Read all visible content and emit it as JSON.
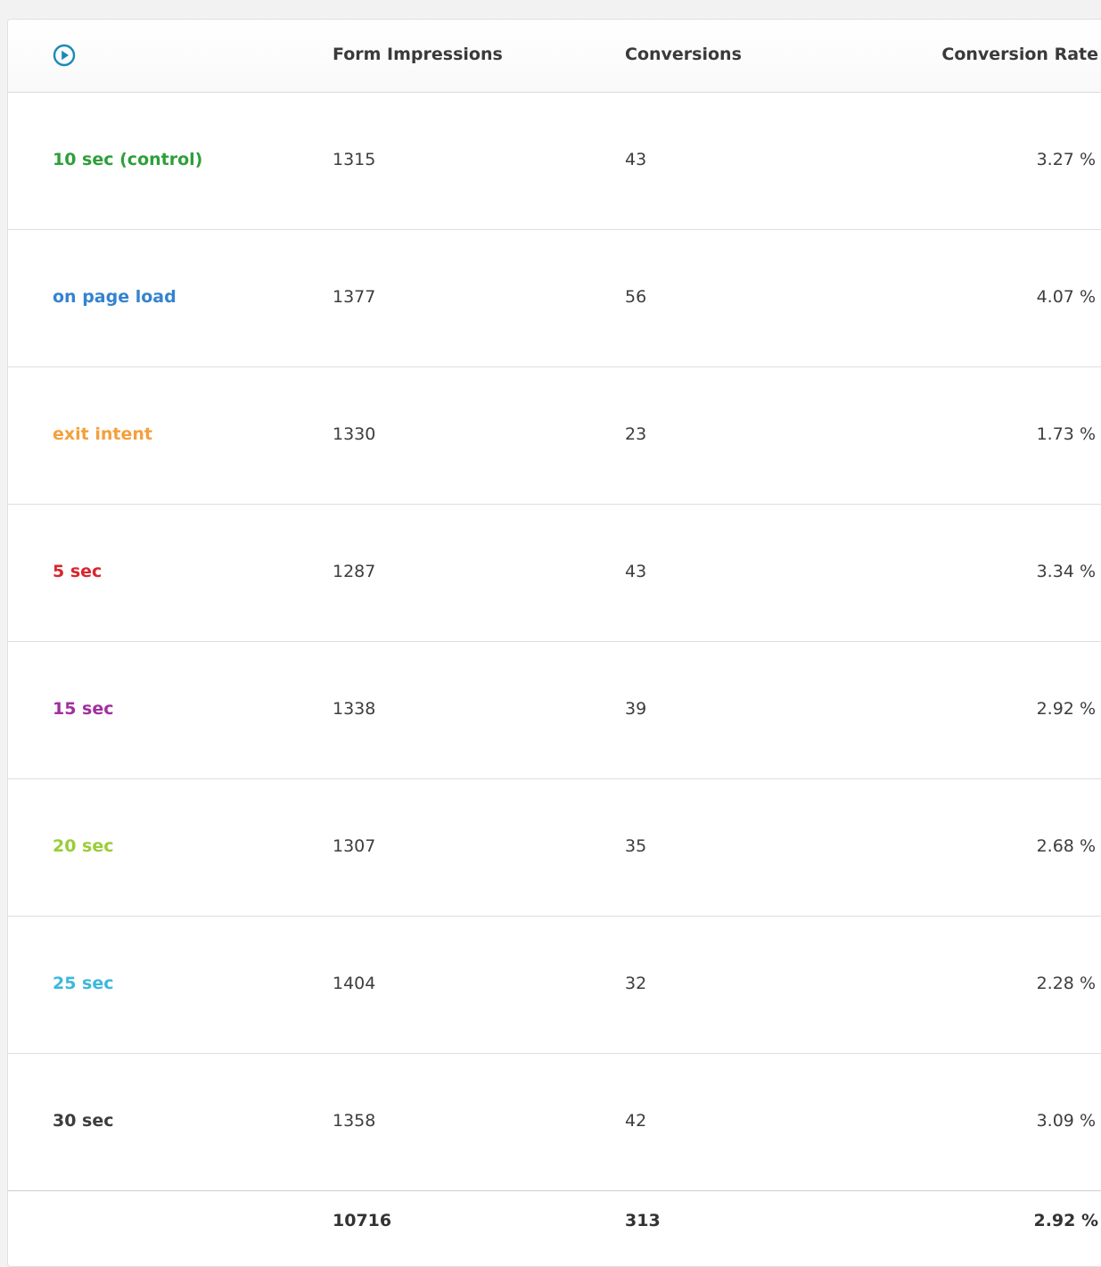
{
  "header": {
    "impressions": "Form Impressions",
    "conversions": "Conversions",
    "rate": "Conversion Rate"
  },
  "icon_color": "#1b8ab5",
  "rows": [
    {
      "name": "10 sec (control)",
      "color": "#2e9f3a",
      "impressions": "1315",
      "conversions": "43",
      "rate": "3.27 %"
    },
    {
      "name": "on page load",
      "color": "#3483cf",
      "impressions": "1377",
      "conversions": "56",
      "rate": "4.07 %"
    },
    {
      "name": "exit intent",
      "color": "#f4a03c",
      "impressions": "1330",
      "conversions": "23",
      "rate": "1.73 %"
    },
    {
      "name": "5 sec",
      "color": "#d9262c",
      "impressions": "1287",
      "conversions": "43",
      "rate": "3.34 %"
    },
    {
      "name": "15 sec",
      "color": "#a12f9f",
      "impressions": "1338",
      "conversions": "39",
      "rate": "2.92 %"
    },
    {
      "name": "20 sec",
      "color": "#9acd3a",
      "impressions": "1307",
      "conversions": "35",
      "rate": "2.68 %"
    },
    {
      "name": "25 sec",
      "color": "#3cb8dd",
      "impressions": "1404",
      "conversions": "32",
      "rate": "2.28 %"
    },
    {
      "name": "30 sec",
      "color": "#3d3d3d",
      "impressions": "1358",
      "conversions": "42",
      "rate": "3.09 %"
    }
  ],
  "total": {
    "impressions": "10716",
    "conversions": "313",
    "rate": "2.92 %"
  }
}
